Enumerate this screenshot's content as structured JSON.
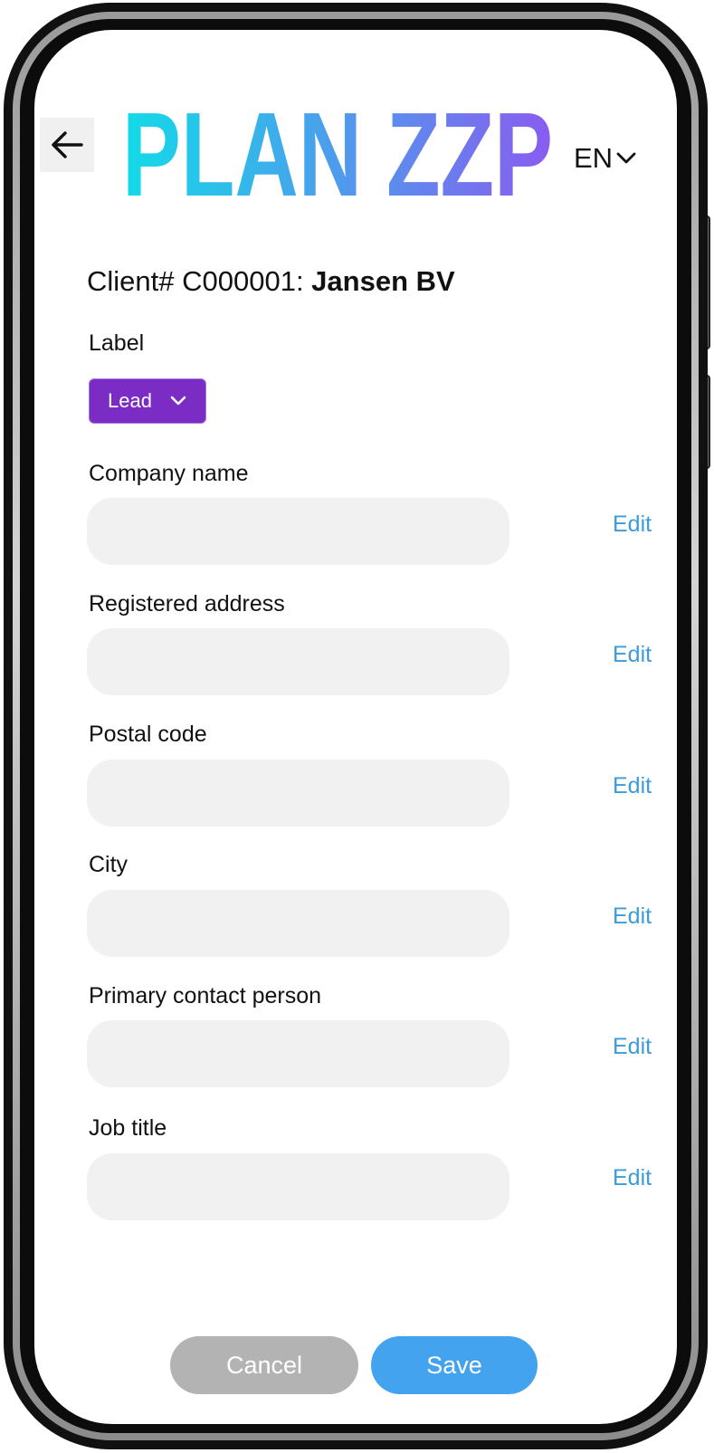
{
  "app": {
    "logo_text": "PLAN ZZP",
    "language": "EN"
  },
  "client": {
    "prefix": "Client# C000001: ",
    "name": "Jansen BV"
  },
  "label_section": {
    "title": "Label",
    "selected": "Lead"
  },
  "fields": [
    {
      "label": "Company name",
      "value": "",
      "edit": "Edit"
    },
    {
      "label": "Registered address",
      "value": "",
      "edit": "Edit"
    },
    {
      "label": "Postal code",
      "value": "",
      "edit": "Edit"
    },
    {
      "label": "City",
      "value": "",
      "edit": "Edit"
    },
    {
      "label": "Primary contact person",
      "value": "",
      "edit": "Edit"
    },
    {
      "label": "Job title",
      "value": "",
      "edit": "Edit"
    }
  ],
  "actions": {
    "cancel": "Cancel",
    "save": "Save"
  },
  "colors": {
    "logo_gradient_start": "#12dbe8",
    "logo_gradient_end": "#8a5cf0",
    "label_tag": "#7b2cc4",
    "edit_link": "#3d9bd9",
    "save_button": "#43a3ee",
    "cancel_button": "#b3b3b3"
  },
  "icons": {
    "back": "arrow-left-icon",
    "language_dropdown": "chevron-down-icon",
    "label_dropdown": "chevron-down-icon"
  }
}
